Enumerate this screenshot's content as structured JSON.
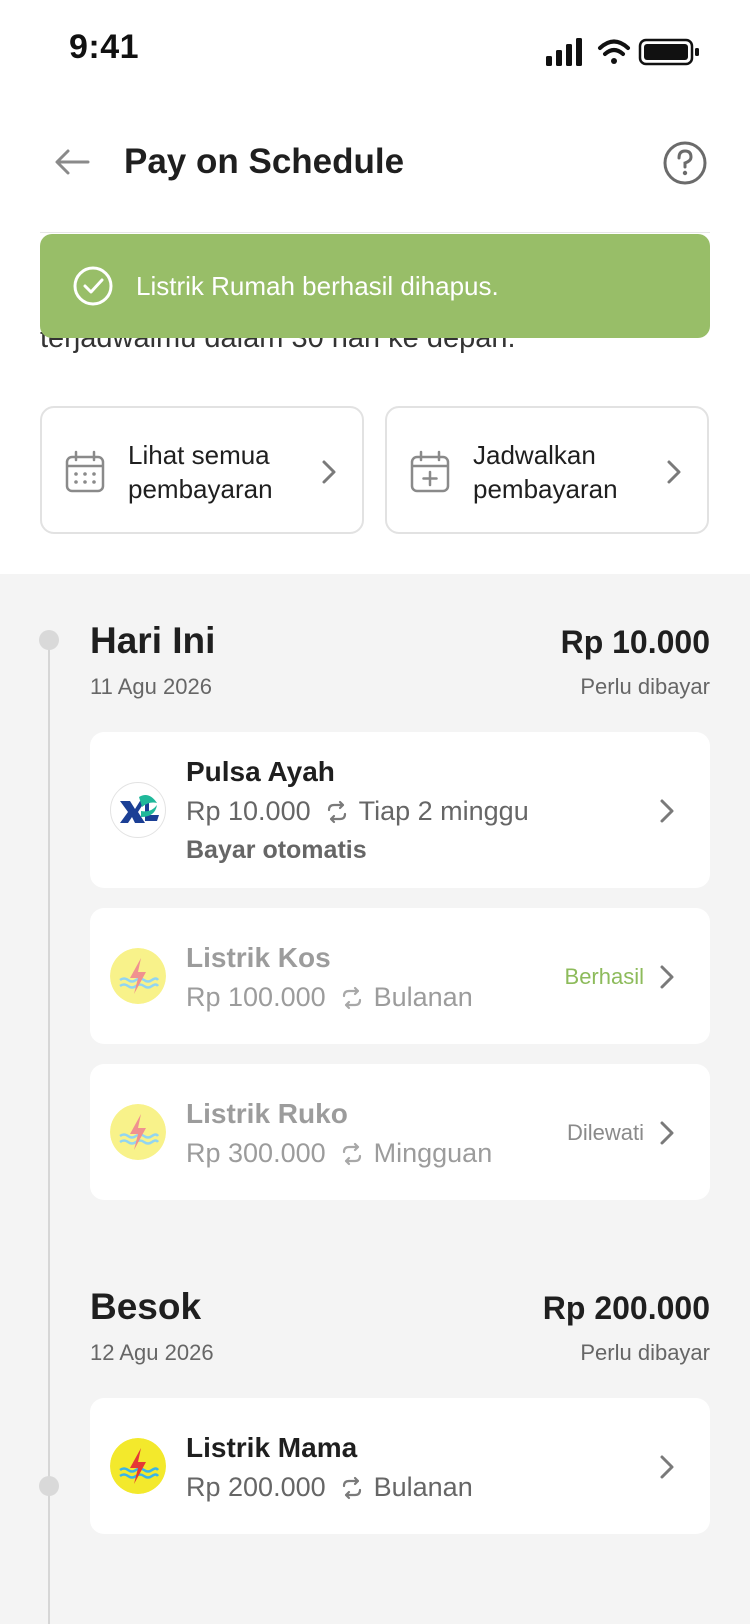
{
  "status_bar": {
    "time": "9:41"
  },
  "header": {
    "title": "Pay on Schedule"
  },
  "intro": {
    "visible_text": "terjadwalmu dalam 30 hari ke depan."
  },
  "toast": {
    "message": "Listrik Rumah berhasil dihapus.",
    "color": "#98be68"
  },
  "actions": [
    {
      "label": "Lihat semua pembayaran",
      "icon": "calendar-icon"
    },
    {
      "label": "Jadwalkan pembayaran",
      "icon": "calendar-add-icon"
    }
  ],
  "days": [
    {
      "title": "Hari Ini",
      "date": "11 Agu 2026",
      "amount": "Rp 10.000",
      "status": "Perlu dibayar",
      "bills": [
        {
          "name": "Pulsa Ayah",
          "amount": "Rp 10.000",
          "frequency": "Tiap 2 minggu",
          "note": "Bayar otomatis",
          "logo": "xl-logo",
          "tag": ""
        },
        {
          "name": "Listrik Kos",
          "amount": "Rp 100.000",
          "frequency": "Bulanan",
          "logo": "pln-logo",
          "tag": "Berhasil"
        },
        {
          "name": "Listrik Ruko",
          "amount": "Rp 300.000",
          "frequency": "Mingguan",
          "logo": "pln-logo",
          "tag": "Dilewati"
        }
      ]
    },
    {
      "title": "Besok",
      "date": "12 Agu 2026",
      "amount": "Rp 200.000",
      "status": "Perlu dibayar",
      "bills": [
        {
          "name": "Listrik Mama",
          "amount": "Rp 200.000",
          "frequency": "Bulanan",
          "logo": "pln-logo",
          "tag": ""
        }
      ]
    }
  ],
  "colors": {
    "success_tag": "#8dbb5b",
    "skipped_tag": "#8a8a8a",
    "toast": "#98be68"
  }
}
